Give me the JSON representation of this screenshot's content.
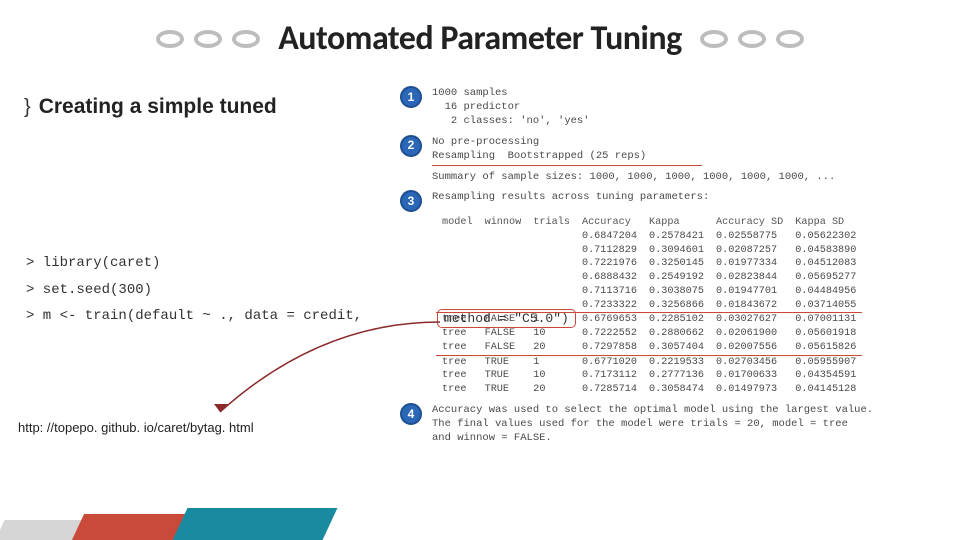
{
  "title": "Automated Parameter Tuning",
  "bullet": {
    "mark": "}",
    "text": "Creating a simple tuned"
  },
  "code": {
    "l1": "> library(caret)",
    "l2": "> set.seed(300)",
    "l3": "> m <- train(default ~ ., data = credit,"
  },
  "method_box": "method = \"C5.0\")",
  "footer_url": "http: //topepo. github. io/caret/bytag. html",
  "steps": {
    "s1": {
      "num": "1",
      "l1": "1000 samples",
      "l2": "  16 predictor",
      "l3": "   2 classes: 'no', 'yes'"
    },
    "s2": {
      "num": "2",
      "l1": "No pre-processing",
      "l2": "Resampling  Bootstrapped (25 reps)",
      "l3": "Summary of sample sizes: 1000, 1000, 1000, 1000, 1000, 1000, ..."
    },
    "s3": {
      "num": "3",
      "l1": "Resampling results across tuning parameters:"
    },
    "s4": {
      "num": "4",
      "l1": "Accuracy was used to select the optimal model using  the largest value.",
      "l2": "The final values used for the model were trials = 20, model = tree",
      "l3": " and winnow = FALSE."
    }
  },
  "table": {
    "headers": [
      "model",
      "winnow",
      "trials",
      "Accuracy",
      "Kappa",
      "Accuracy SD",
      "Kappa SD"
    ],
    "rows": [
      {
        "model": "",
        "winnow": "",
        "trials": "",
        "acc": "0.6847204",
        "kappa": "0.2578421",
        "accsd": "0.02558775",
        "kappasd": "0.05622302"
      },
      {
        "model": "",
        "winnow": "",
        "trials": "",
        "acc": "0.7112829",
        "kappa": "0.3094601",
        "accsd": "0.02087257",
        "kappasd": "0.04583890"
      },
      {
        "model": "",
        "winnow": "",
        "trials": "",
        "acc": "0.7221976",
        "kappa": "0.3250145",
        "accsd": "0.01977334",
        "kappasd": "0.04512083"
      },
      {
        "model": "",
        "winnow": "",
        "trials": "",
        "acc": "0.6888432",
        "kappa": "0.2549192",
        "accsd": "0.02823844",
        "kappasd": "0.05695277"
      },
      {
        "model": "",
        "winnow": "",
        "trials": "",
        "acc": "0.7113716",
        "kappa": "0.3038075",
        "accsd": "0.01947701",
        "kappasd": "0.04484956"
      },
      {
        "model": "",
        "winnow": "",
        "trials": "",
        "acc": "0.7233322",
        "kappa": "0.3256866",
        "accsd": "0.01843672",
        "kappasd": "0.03714055"
      },
      {
        "model": "tree",
        "winnow": "FALSE",
        "trials": "1",
        "acc": "0.6769653",
        "kappa": "0.2285102",
        "accsd": "0.03027627",
        "kappasd": "0.07001131"
      },
      {
        "model": "tree",
        "winnow": "FALSE",
        "trials": "10",
        "acc": "0.7222552",
        "kappa": "0.2880662",
        "accsd": "0.02061900",
        "kappasd": "0.05601918"
      },
      {
        "model": "tree",
        "winnow": "FALSE",
        "trials": "20",
        "acc": "0.7297858",
        "kappa": "0.3057404",
        "accsd": "0.02007556",
        "kappasd": "0.05615826"
      },
      {
        "model": "tree",
        "winnow": "TRUE",
        "trials": "1",
        "acc": "0.6771020",
        "kappa": "0.2219533",
        "accsd": "0.02703456",
        "kappasd": "0.05955907"
      },
      {
        "model": "tree",
        "winnow": "TRUE",
        "trials": "10",
        "acc": "0.7173112",
        "kappa": "0.2777136",
        "accsd": "0.01700633",
        "kappasd": "0.04354591"
      },
      {
        "model": "tree",
        "winnow": "TRUE",
        "trials": "20",
        "acc": "0.7285714",
        "kappa": "0.3058474",
        "accsd": "0.01497973",
        "kappasd": "0.04145128"
      }
    ]
  }
}
